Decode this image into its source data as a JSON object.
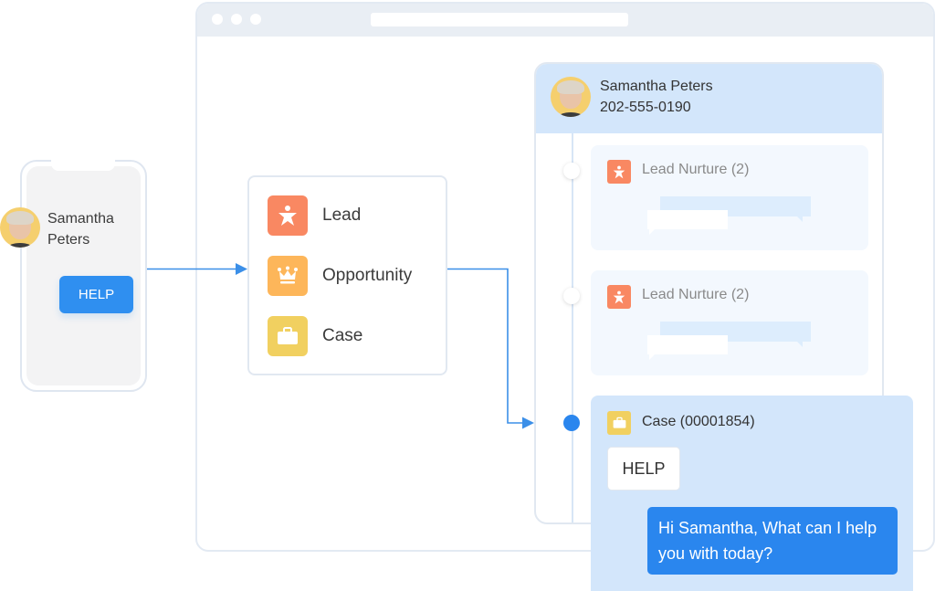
{
  "browser": {
    "window_controls": [
      "close-dot",
      "minimize-dot",
      "maximize-dot"
    ],
    "address_bar": ""
  },
  "phone": {
    "contact_name": "Samantha Peters",
    "help_button": "HELP"
  },
  "type_menu": {
    "items": [
      {
        "label": "Lead",
        "icon": "person-star-icon",
        "color": "#f98862"
      },
      {
        "label": "Opportunity",
        "icon": "crown-icon",
        "color": "#fdb65a"
      },
      {
        "label": "Case",
        "icon": "briefcase-icon",
        "color": "#f1d060"
      }
    ]
  },
  "panel": {
    "contact_name": "Samantha Peters",
    "contact_phone": "202-555-0190",
    "timeline": [
      {
        "title": "Lead Nurture (2)",
        "icon": "person-star-icon",
        "active": false
      },
      {
        "title": "Lead Nurture (2)",
        "icon": "person-star-icon",
        "active": false
      },
      {
        "title": "Case (00001854)",
        "icon": "briefcase-icon",
        "active": true,
        "messages": [
          {
            "from": "customer",
            "text": "HELP"
          },
          {
            "from": "agent",
            "text": "Hi Samantha, What can I help you with today?"
          }
        ]
      }
    ]
  },
  "colors": {
    "accent_blue": "#2a86ee",
    "header_blue": "#d3e6fb",
    "lead": "#f98862",
    "opportunity": "#fdb65a",
    "case": "#f1d060"
  }
}
